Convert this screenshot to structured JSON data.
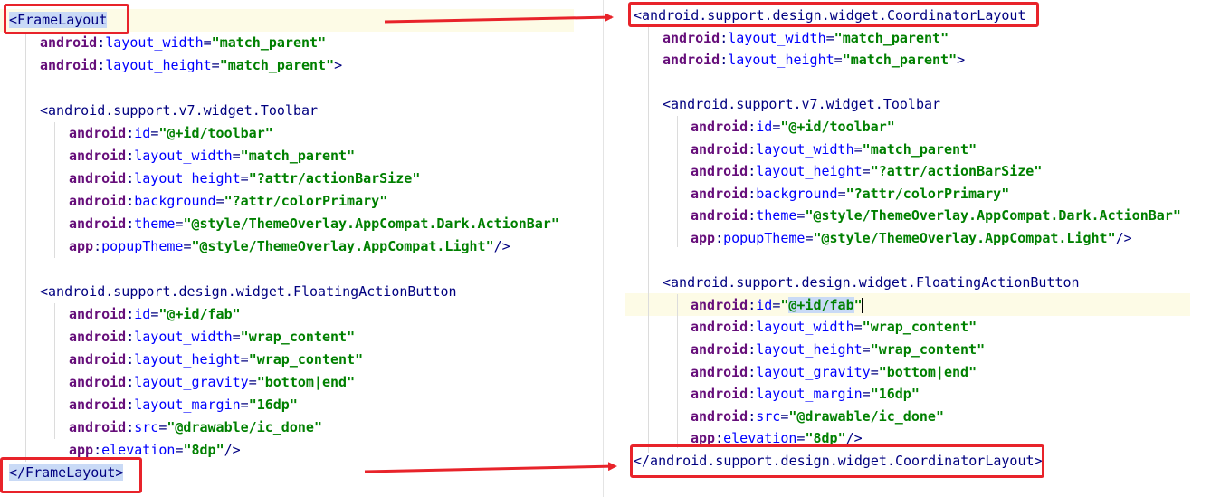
{
  "colors": {
    "tag": "#000080",
    "attr_namespace": "#660e7a",
    "attr_name": "#0000ff",
    "value": "#008000",
    "highlight_box": "#e8232a",
    "current_line": "#fdfbe6"
  },
  "left": {
    "root_open": "FrameLayout",
    "root_close": "/FrameLayout",
    "lines": [
      {
        "ns": "android",
        "name": "layout_width",
        "value": "match_parent",
        "end": ""
      },
      {
        "ns": "android",
        "name": "layout_height",
        "value": "match_parent",
        "end": ">"
      },
      {
        "ns": "android",
        "name": "id",
        "value": "@+id/toolbar",
        "end": ""
      },
      {
        "ns": "android",
        "name": "layout_width",
        "value": "match_parent",
        "end": ""
      },
      {
        "ns": "android",
        "name": "layout_height",
        "value": "?attr/actionBarSize",
        "end": ""
      },
      {
        "ns": "android",
        "name": "background",
        "value": "?attr/colorPrimary",
        "end": ""
      },
      {
        "ns": "android",
        "name": "theme",
        "value": "@style/ThemeOverlay.AppCompat.Dark.ActionBar",
        "end": ""
      },
      {
        "ns": "app",
        "name": "popupTheme",
        "value": "@style/ThemeOverlay.AppCompat.Light",
        "end": "/>"
      },
      {
        "ns": "android",
        "name": "id",
        "value": "@+id/fab",
        "end": ""
      },
      {
        "ns": "android",
        "name": "layout_width",
        "value": "wrap_content",
        "end": ""
      },
      {
        "ns": "android",
        "name": "layout_height",
        "value": "wrap_content",
        "end": ""
      },
      {
        "ns": "android",
        "name": "layout_gravity",
        "value": "bottom|end",
        "end": ""
      },
      {
        "ns": "android",
        "name": "layout_margin",
        "value": "16dp",
        "end": ""
      },
      {
        "ns": "android",
        "name": "src",
        "value": "@drawable/ic_done",
        "end": ""
      },
      {
        "ns": "app",
        "name": "elevation",
        "value": "8dp",
        "end": "/>"
      }
    ],
    "toolbar_tag": "android.support.v7.widget.Toolbar",
    "fab_tag": "android.support.design.widget.FloatingActionButton"
  },
  "right": {
    "root_open": "android.support.design.widget.CoordinatorLayout",
    "root_close": "/android.support.design.widget.CoordinatorLayout",
    "lines": [
      {
        "ns": "android",
        "name": "layout_width",
        "value": "match_parent",
        "end": ""
      },
      {
        "ns": "android",
        "name": "layout_height",
        "value": "match_parent",
        "end": ">"
      },
      {
        "ns": "android",
        "name": "id",
        "value": "@+id/toolbar",
        "end": ""
      },
      {
        "ns": "android",
        "name": "layout_width",
        "value": "match_parent",
        "end": ""
      },
      {
        "ns": "android",
        "name": "layout_height",
        "value": "?attr/actionBarSize",
        "end": ""
      },
      {
        "ns": "android",
        "name": "background",
        "value": "?attr/colorPrimary",
        "end": ""
      },
      {
        "ns": "android",
        "name": "theme",
        "value": "@style/ThemeOverlay.AppCompat.Dark.ActionBar",
        "end": ""
      },
      {
        "ns": "app",
        "name": "popupTheme",
        "value": "@style/ThemeOverlay.AppCompat.Light",
        "end": "/>"
      },
      {
        "ns": "android",
        "name": "id",
        "value": "@+id/fab",
        "end": ""
      },
      {
        "ns": "android",
        "name": "layout_width",
        "value": "wrap_content",
        "end": ""
      },
      {
        "ns": "android",
        "name": "layout_height",
        "value": "wrap_content",
        "end": ""
      },
      {
        "ns": "android",
        "name": "layout_gravity",
        "value": "bottom|end",
        "end": ""
      },
      {
        "ns": "android",
        "name": "layout_margin",
        "value": "16dp",
        "end": ""
      },
      {
        "ns": "android",
        "name": "src",
        "value": "@drawable/ic_done",
        "end": ""
      },
      {
        "ns": "app",
        "name": "elevation",
        "value": "8dp",
        "end": "/>"
      }
    ],
    "toolbar_tag": "android.support.v7.widget.Toolbar",
    "fab_tag": "android.support.design.widget.FloatingActionButton"
  }
}
